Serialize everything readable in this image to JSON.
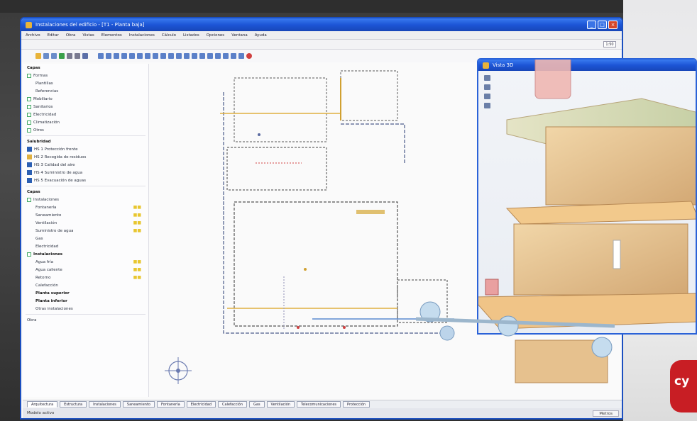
{
  "window": {
    "title": "Instalaciones del edificio - [T1 - Planta baja]",
    "controls": [
      "_",
      "□",
      "×"
    ]
  },
  "menubar": {
    "items": [
      "Archivo",
      "Editar",
      "Obra",
      "Vistas",
      "Elementos",
      "Instalaciones",
      "Cálculo",
      "Listados",
      "Opciones",
      "Ventana",
      "Ayuda"
    ]
  },
  "toolbar_zoom": "1:50",
  "sidebar": {
    "title": "Capas",
    "layers": [
      {
        "label": "Formas",
        "checked": true
      },
      {
        "label": "Plantillas",
        "checked": false
      },
      {
        "label": "Referencias",
        "checked": false
      },
      {
        "label": "Mobiliario",
        "checked": true
      },
      {
        "label": "Sanitarios",
        "checked": true
      },
      {
        "label": "Electricidad",
        "checked": true
      },
      {
        "label": "Climatización",
        "checked": true
      },
      {
        "label": "Otros",
        "checked": true
      }
    ],
    "section_salubridad": "Salubridad",
    "salubridad_items": [
      {
        "label": "HS 1 Protección frente",
        "color": "#2b5fb3"
      },
      {
        "label": "HS 2 Recogida de residuos",
        "color": "#e0b040"
      },
      {
        "label": "HS 3 Calidad del aire",
        "color": "#2b5fb3"
      },
      {
        "label": "HS 4 Suministro de agua",
        "color": "#2b5fb3"
      },
      {
        "label": "HS 5 Evacuación de aguas",
        "color": "#2b5fb3"
      }
    ],
    "section_capas": "Capas",
    "instalaciones_label": "Instalaciones",
    "inst_items": [
      "Fontanería",
      "Saneamiento",
      "Ventilación",
      "Suministro de agua",
      "Gas",
      "Electricidad"
    ],
    "section_inst2": "Instalaciones",
    "inst2_items": [
      "Agua fría",
      "Agua caliente",
      "Retorno",
      "Calefacción",
      "Planta superior",
      "Planta inferior",
      "Otras instalaciones"
    ],
    "footer_label": "Obra"
  },
  "tabs": [
    "Arquitectura",
    "Estructura",
    "Instalaciones",
    "Saneamiento",
    "Fontanería",
    "Electricidad",
    "Calefacción",
    "Gas",
    "Ventilación",
    "Telecomunicaciones",
    "Protección"
  ],
  "status": {
    "left": "Modelo activo",
    "right": "Metros"
  },
  "window_3d": {
    "title": "Vista 3D"
  },
  "brand": "cy",
  "colors": {
    "titlebar": "#1c55d6",
    "accent_red": "#c81e24"
  }
}
